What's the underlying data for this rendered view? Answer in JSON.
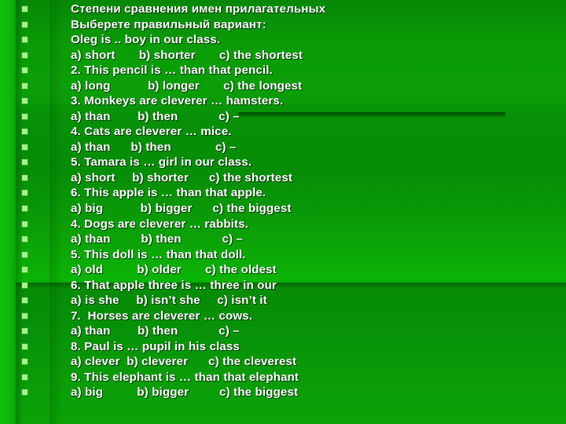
{
  "slide": {
    "title": "Степени сравнения имен прилагательных",
    "instruction": "Выберете правильный вариант:",
    "background_color": "#0a9a0a",
    "left_stripe_color": "#12bf0c",
    "bullet_color": "#a8f08c",
    "text_color": "#ffffff",
    "bullet_icon": "square-bullet",
    "line_count": 26
  },
  "lines": [
    {
      "text": "Степени сравнения имен прилагательных",
      "bullet": true
    },
    {
      "text": "Выберете правильный вариант:",
      "bullet": true
    },
    {
      "text": "Oleg is .. boy in our class.",
      "bullet": true
    },
    {
      "text": "a) short       b) shorter       c) the shortest",
      "bullet": true
    },
    {
      "text": "2. This pencil is … than that pencil.",
      "bullet": true
    },
    {
      "text": "a) long           b) longer       c) the longest",
      "bullet": true
    },
    {
      "text": "3. Monkeys are cleverer … hamsters.",
      "bullet": true
    },
    {
      "text": "a) than        b) then            c) –",
      "bullet": true
    },
    {
      "text": "4. Cats are cleverer … mice.",
      "bullet": true
    },
    {
      "text": "a) than      b) then             c) –",
      "bullet": true
    },
    {
      "text": "5. Tamara is … girl in our class.",
      "bullet": true
    },
    {
      "text": "a) short     b) shorter      c) the shortest",
      "bullet": true
    },
    {
      "text": "6. This apple is … than that apple.",
      "bullet": true
    },
    {
      "text": "a) big           b) bigger      c) the biggest",
      "bullet": true
    },
    {
      "text": "4. Dogs are cleverer … rabbits.",
      "bullet": true
    },
    {
      "text": "a) than         b) then            c) –",
      "bullet": true
    },
    {
      "text": "5. This doll is … than that doll.",
      "bullet": true
    },
    {
      "text": "a) old          b) older       c) the oldest",
      "bullet": true
    },
    {
      "text": "6. That apple three is … three in our",
      "bullet": true
    },
    {
      "text": "a) is she     b) isn’t she     c) isn’t it",
      "bullet": true
    },
    {
      "text": "7.  Horses are cleverer … cows.",
      "bullet": true
    },
    {
      "text": "a) than        b) then            c) –",
      "bullet": true
    },
    {
      "text": "8. Paul is … pupil in his class",
      "bullet": true
    },
    {
      "text": "a) clever  b) cleverer      c) the cleverest",
      "bullet": true
    },
    {
      "text": "9. This elephant is … than that elephant",
      "bullet": true
    },
    {
      "text": "a) big          b) bigger         c) the biggest",
      "bullet": true
    }
  ]
}
